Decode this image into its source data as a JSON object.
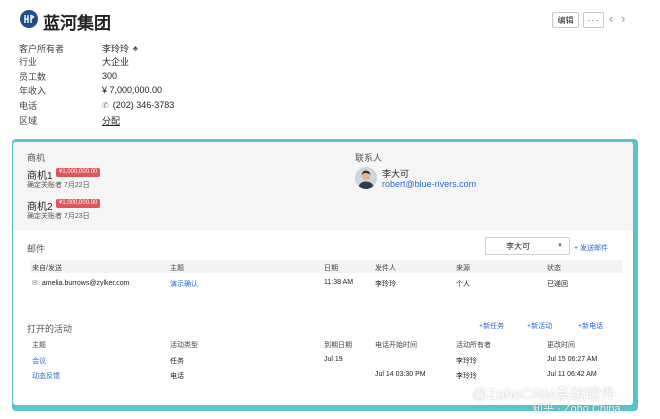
{
  "header": {
    "title": "蓝河集团",
    "edit_label": "编辑",
    "more_label": "···",
    "prev_label": "‹",
    "next_label": "›"
  },
  "fields": [
    {
      "label": "客户所有者",
      "value": "李玲玲"
    },
    {
      "label": "行业",
      "value": "大企业"
    },
    {
      "label": "员工数",
      "value": "300"
    },
    {
      "label": "年收入",
      "value": "¥ 7,000,000.00"
    },
    {
      "label": "电话",
      "value": "(202) 346-3783"
    },
    {
      "label": "区域",
      "value": "分配"
    }
  ],
  "deals": {
    "section_label": "商机",
    "items": [
      {
        "name": "商机1",
        "amount": "¥1,000,000.00",
        "sub": "确定关账者 7月22日"
      },
      {
        "name": "商机2",
        "amount": "¥1,000,000.00",
        "sub": "确定关账者 7月23日"
      }
    ]
  },
  "contacts": {
    "section_label": "联系人",
    "name": "李大可",
    "email": "robert@blue-rivers.com"
  },
  "mail": {
    "section_label": "邮件",
    "owner_select": "李大可",
    "send_link": "+ 发送邮件",
    "columns": [
      "来自/发送",
      "主题",
      "日期",
      "发件人",
      "来源",
      "状态"
    ],
    "rows": [
      {
        "from": "amelia.burrows@zylker.com",
        "subject": "演示确认",
        "date": "11:38 AM",
        "sender": "李玲玲",
        "source": "个人",
        "status": "已递回"
      }
    ]
  },
  "activities": {
    "section_label": "打开的活动",
    "new_task": "+新任务",
    "new_event": "+新活动",
    "new_call": "+新电话",
    "columns": [
      "主题",
      "活动类型",
      "到期日期",
      "电话开始时间",
      "活动所有者",
      "更改时间"
    ],
    "rows": [
      {
        "subject": "会议",
        "type": "任务",
        "due": "Jul 19",
        "call_start": "",
        "owner": "李玲玲",
        "modified": "Jul 15 06:27 AM"
      },
      {
        "subject": "动态反馈",
        "type": "电话",
        "due": "",
        "call_start": "Jul 14 03:30 PM",
        "owner": "李玲玲",
        "modified": "Jul 11 06:42 AM"
      }
    ]
  },
  "watermark": {
    "line1": "@ZohoCRM系统软件",
    "line2": "知乎 · Zoho China"
  },
  "colors": {
    "accent_teal": "#5bc3cd",
    "link_blue": "#2a6ac7",
    "amount_red": "#e0555c",
    "logo_blue": "#1f4e8c"
  }
}
